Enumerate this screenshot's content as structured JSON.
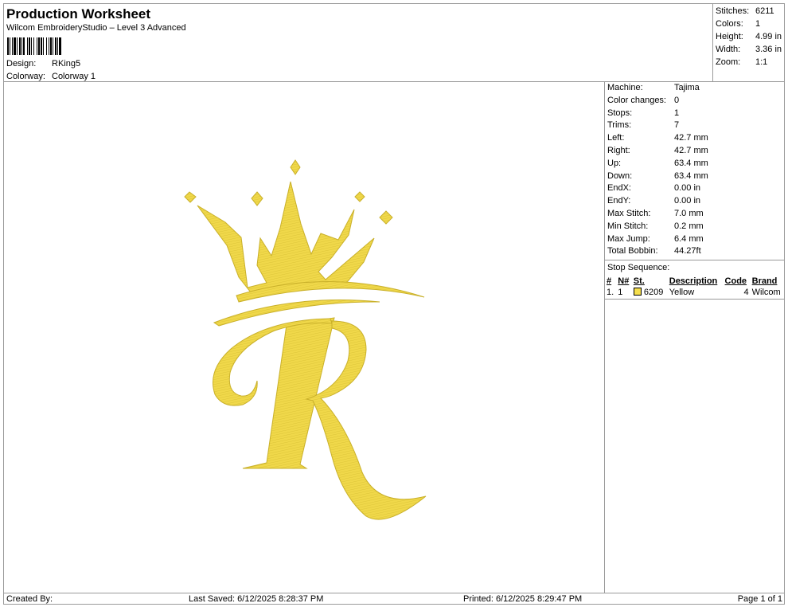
{
  "header": {
    "title": "Production Worksheet",
    "subtitle": "Wilcom EmbroideryStudio – Level 3 Advanced",
    "design_label": "Design:",
    "design_value": "RKing5",
    "colorway_label": "Colorway:",
    "colorway_value": "Colorway 1"
  },
  "summary": [
    {
      "label": "Stitches:",
      "value": "6211"
    },
    {
      "label": "Colors:",
      "value": "1"
    },
    {
      "label": "Height:",
      "value": "4.99 in"
    },
    {
      "label": "Width:",
      "value": "3.36 in"
    },
    {
      "label": "Zoom:",
      "value": "1:1"
    }
  ],
  "machine_info": [
    {
      "label": "Machine:",
      "value": "Tajima"
    },
    {
      "label": "Color changes:",
      "value": "0"
    },
    {
      "label": "Stops:",
      "value": "1"
    },
    {
      "label": "Trims:",
      "value": "7"
    },
    {
      "label": "Left:",
      "value": "42.7 mm"
    },
    {
      "label": "Right:",
      "value": "42.7 mm"
    },
    {
      "label": "Up:",
      "value": "63.4 mm"
    },
    {
      "label": "Down:",
      "value": "63.4 mm"
    },
    {
      "label": "EndX:",
      "value": "0.00 in"
    },
    {
      "label": "EndY:",
      "value": "0.00 in"
    },
    {
      "label": "Max Stitch:",
      "value": "7.0 mm"
    },
    {
      "label": "Min Stitch:",
      "value": "0.2 mm"
    },
    {
      "label": "Max Jump:",
      "value": "6.4 mm"
    },
    {
      "label": "Total Bobbin:",
      "value": "44.27ft"
    }
  ],
  "stop_sequence": {
    "title": "Stop Sequence:",
    "columns": [
      "#",
      "N#",
      "St.",
      "Description",
      "Code",
      "Brand"
    ],
    "rows": [
      {
        "num": "1.",
        "n": "1",
        "swatch_color": "#f5df4d",
        "st": "6209",
        "description": "Yellow",
        "code": "4",
        "brand": "Wilcom"
      }
    ]
  },
  "footer": {
    "created_by": "Created By:",
    "last_saved": "Last Saved: 6/12/2025 8:28:37 PM",
    "printed": "Printed: 6/12/2025 8:29:47 PM",
    "page": "Page 1 of 1"
  },
  "colors": {
    "thread": "#f0d84a",
    "thread_shadow": "#c9b02a",
    "border": "#9a9a9a"
  },
  "design_icon": "crowned-letter-r-embroidery"
}
